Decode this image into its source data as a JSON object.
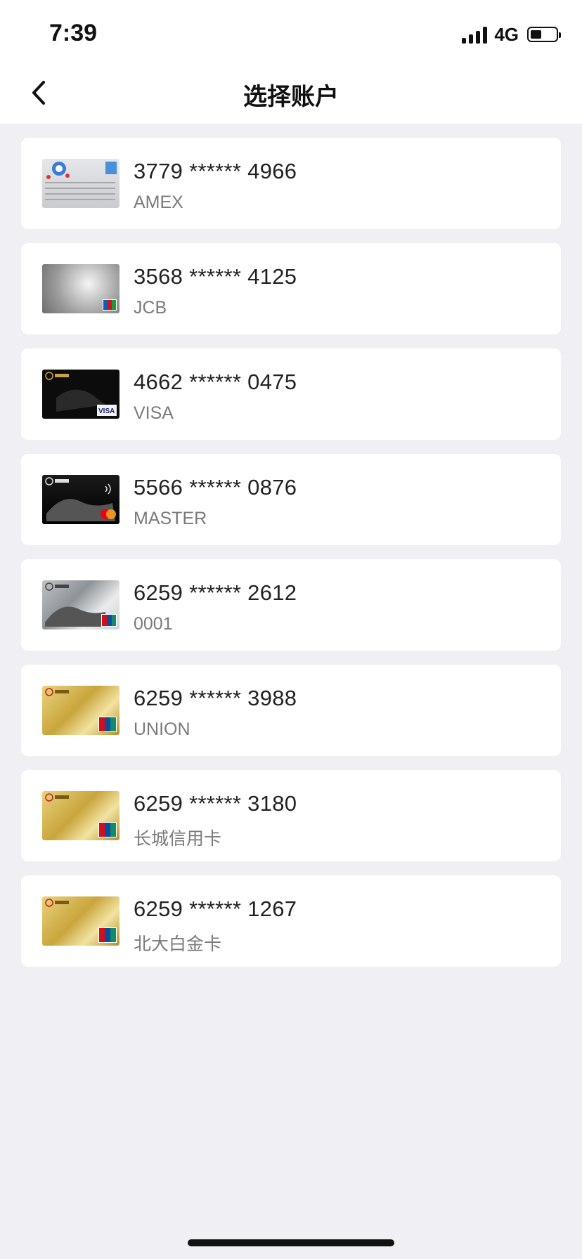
{
  "status_bar": {
    "time": "7:39",
    "network": "4G"
  },
  "nav": {
    "title": "选择账户"
  },
  "cards": [
    {
      "number": "3779 ****** 4966",
      "type": "AMEX",
      "thumb": "amex"
    },
    {
      "number": "3568 ****** 4125",
      "type": "JCB",
      "thumb": "jcb"
    },
    {
      "number": "4662 ****** 0475",
      "type": "VISA",
      "thumb": "visa"
    },
    {
      "number": "5566 ****** 0876",
      "type": "MASTER",
      "thumb": "master"
    },
    {
      "number": "6259 ****** 2612",
      "type": "0001",
      "thumb": "union-silver"
    },
    {
      "number": "6259 ****** 3988",
      "type": "UNION",
      "thumb": "gold"
    },
    {
      "number": "6259 ****** 3180",
      "type": "长城信用卡",
      "thumb": "gold"
    },
    {
      "number": "6259 ****** 1267",
      "type": "北大白金卡",
      "thumb": "gold"
    }
  ],
  "colors": {
    "background": "#efeff4",
    "card_bg": "#ffffff",
    "secondary_text": "#7a7a7a"
  }
}
